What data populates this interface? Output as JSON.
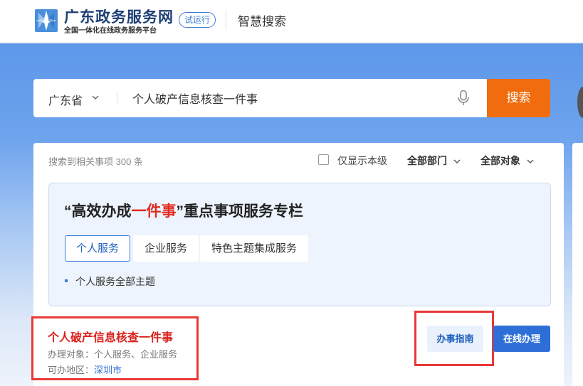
{
  "header": {
    "site_name": "广东政务服务网",
    "site_subtitle": "全国一体化在线政务服务平台",
    "trial_badge": "试运行",
    "section_title": "智慧搜索"
  },
  "search": {
    "region": "广东省",
    "query": "个人破产信息核查一件事",
    "button_label": "搜索"
  },
  "filters": {
    "result_count": "搜索到相关事项 300 条",
    "local_only_label": "仅显示本级",
    "local_only_checked": false,
    "department": "全部部门",
    "target": "全部对象"
  },
  "feature": {
    "title_prefix": "“高效办成",
    "title_highlight": "一件事",
    "title_suffix": "”重点事项服务专栏",
    "tabs": [
      {
        "label": "个人服务",
        "active": true
      },
      {
        "label": "企业服务",
        "active": false
      },
      {
        "label": "特色主题集成服务",
        "active": false
      }
    ],
    "sub_topic": "个人服务全部主题"
  },
  "result": {
    "title": "个人破产信息核查一件事",
    "target_line": "办理对象：个人服务、企业服务",
    "area_label": "可办地区：",
    "area_value": "深圳市",
    "guide_button": "办事指南",
    "online_button": "在线办理"
  },
  "colors": {
    "brand": "#1c3d73",
    "search_button": "#f06c0e",
    "highlight": "#e02a1f",
    "primary_blue": "#2e6fd7"
  }
}
